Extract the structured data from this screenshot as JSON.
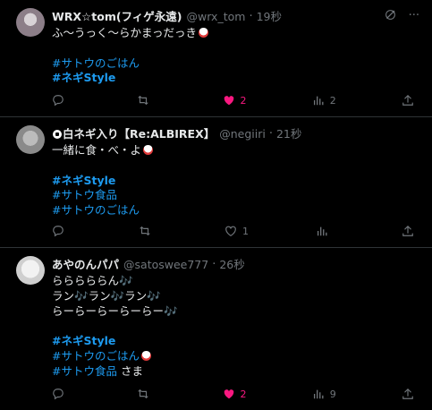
{
  "posts": [
    {
      "name": "WRX☆tom(フィゲ永遠)",
      "handle": "@wrx_tom",
      "time": "19秒",
      "lines": [
        {
          "text": "ふ〜うっく〜らかまっだっき",
          "rice": true
        },
        {
          "text": ""
        },
        {
          "text": "#サトウのごはん",
          "tag": true
        },
        {
          "text": "#ネギStyle",
          "tag": true,
          "bold": true
        }
      ],
      "replies": "",
      "reposts": "",
      "likes": "2",
      "liked": true,
      "views": "2"
    },
    {
      "name": "白ネギ入り【Re:ALBIREX】",
      "handle": "@negiiri",
      "time": "21秒",
      "lines": [
        {
          "text": "一緒に食・べ・よ",
          "rice": true
        },
        {
          "text": ""
        },
        {
          "text": "#ネギStyle",
          "tag": true,
          "bold": true
        },
        {
          "text": "#サトウ食品",
          "tag": true
        },
        {
          "text": "#サトウのごはん",
          "tag": true
        }
      ],
      "replies": "",
      "reposts": "",
      "likes": "1",
      "liked": false,
      "views": ""
    },
    {
      "name": "あやのんパパ",
      "handle": "@satoswee777",
      "time": "26秒",
      "lines": [
        {
          "text": "らららららん🎶"
        },
        {
          "text": "ラン🎶ラン🎶ラン🎶"
        },
        {
          "text": "らーらーらーらーらー🎶"
        },
        {
          "text": ""
        },
        {
          "text": "#ネギStyle",
          "tag": true,
          "bold": true
        },
        {
          "text": "#サトウのごはん",
          "tag": true,
          "rice": true
        },
        {
          "text": "#サトウ食品",
          "tag": true,
          "suffix": " さま"
        }
      ],
      "replies": "",
      "reposts": "",
      "likes": "2",
      "liked": true,
      "views": "9"
    }
  ],
  "icons": {
    "grok": "grok-icon",
    "more": "more-icon",
    "reply": "reply-icon",
    "repost": "repost-icon",
    "like": "heart-icon",
    "views": "views-icon",
    "share": "share-icon"
  },
  "colors": {
    "background": "#000000",
    "link": "#1d9bf0",
    "like": "#f91880",
    "muted": "#71767b"
  }
}
